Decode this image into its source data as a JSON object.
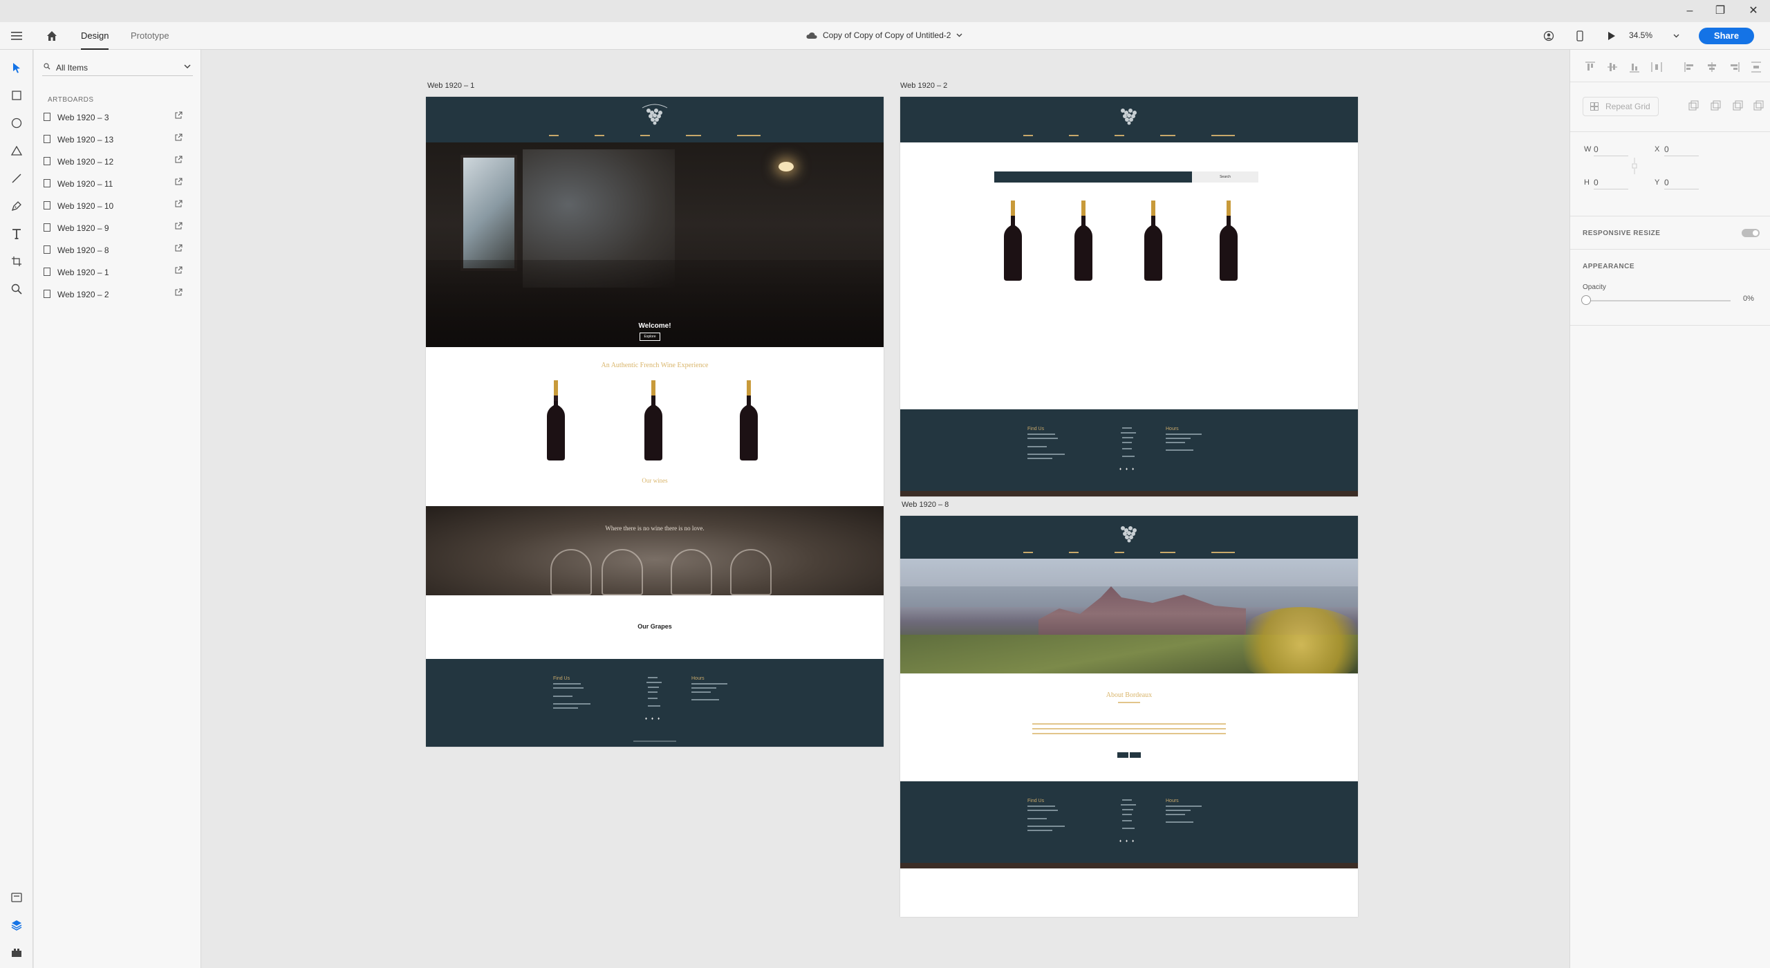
{
  "window": {
    "minimize": "–",
    "restore": "❐",
    "close": "✕"
  },
  "topbar": {
    "tabs": [
      {
        "label": "Design",
        "active": true
      },
      {
        "label": "Prototype",
        "active": false
      }
    ],
    "doc_title": "Copy of Copy of Copy of Untitled-2",
    "zoom": "34.5%",
    "share": "Share"
  },
  "layers": {
    "filter_label": "All Items",
    "section_title": "ARTBOARDS",
    "items": [
      "Web 1920 – 3",
      "Web 1920 – 13",
      "Web 1920 – 12",
      "Web 1920 – 11",
      "Web 1920 – 10",
      "Web 1920 – 9",
      "Web 1920 – 8",
      "Web 1920 – 1",
      "Web 1920 – 2"
    ]
  },
  "inspector": {
    "repeat_grid": "Repeat Grid",
    "w_label": "W",
    "w_value": "0",
    "x_label": "X",
    "x_value": "0",
    "h_label": "H",
    "h_value": "0",
    "y_label": "Y",
    "y_value": "0",
    "responsive_resize": "RESPONSIVE RESIZE",
    "appearance": "APPEARANCE",
    "opacity_label": "Opacity",
    "opacity_value": "0%"
  },
  "canvas": {
    "artboard1": {
      "label": "Web 1920 – 1",
      "hero_title": "Welcome!",
      "hero_button": "Explore",
      "tagline": "An Authentic French Wine Experience",
      "wines_link": "Our wines",
      "quote": "Where there is no wine there is no love.",
      "grapes_heading": "Our Grapes",
      "footer_find": "Find Us",
      "footer_hours": "Hours"
    },
    "artboard2": {
      "label": "Web 1920 – 2",
      "search_button": "Search",
      "footer_find": "Find Us",
      "footer_hours": "Hours"
    },
    "artboard3": {
      "label": "Web 1920 – 8",
      "about_title": "About Bordeaux",
      "footer_find": "Find Us",
      "footer_hours": "Hours"
    }
  },
  "colors": {
    "accent": "#1473e6",
    "site_navy": "#233640",
    "site_gold": "#d9b56b"
  }
}
